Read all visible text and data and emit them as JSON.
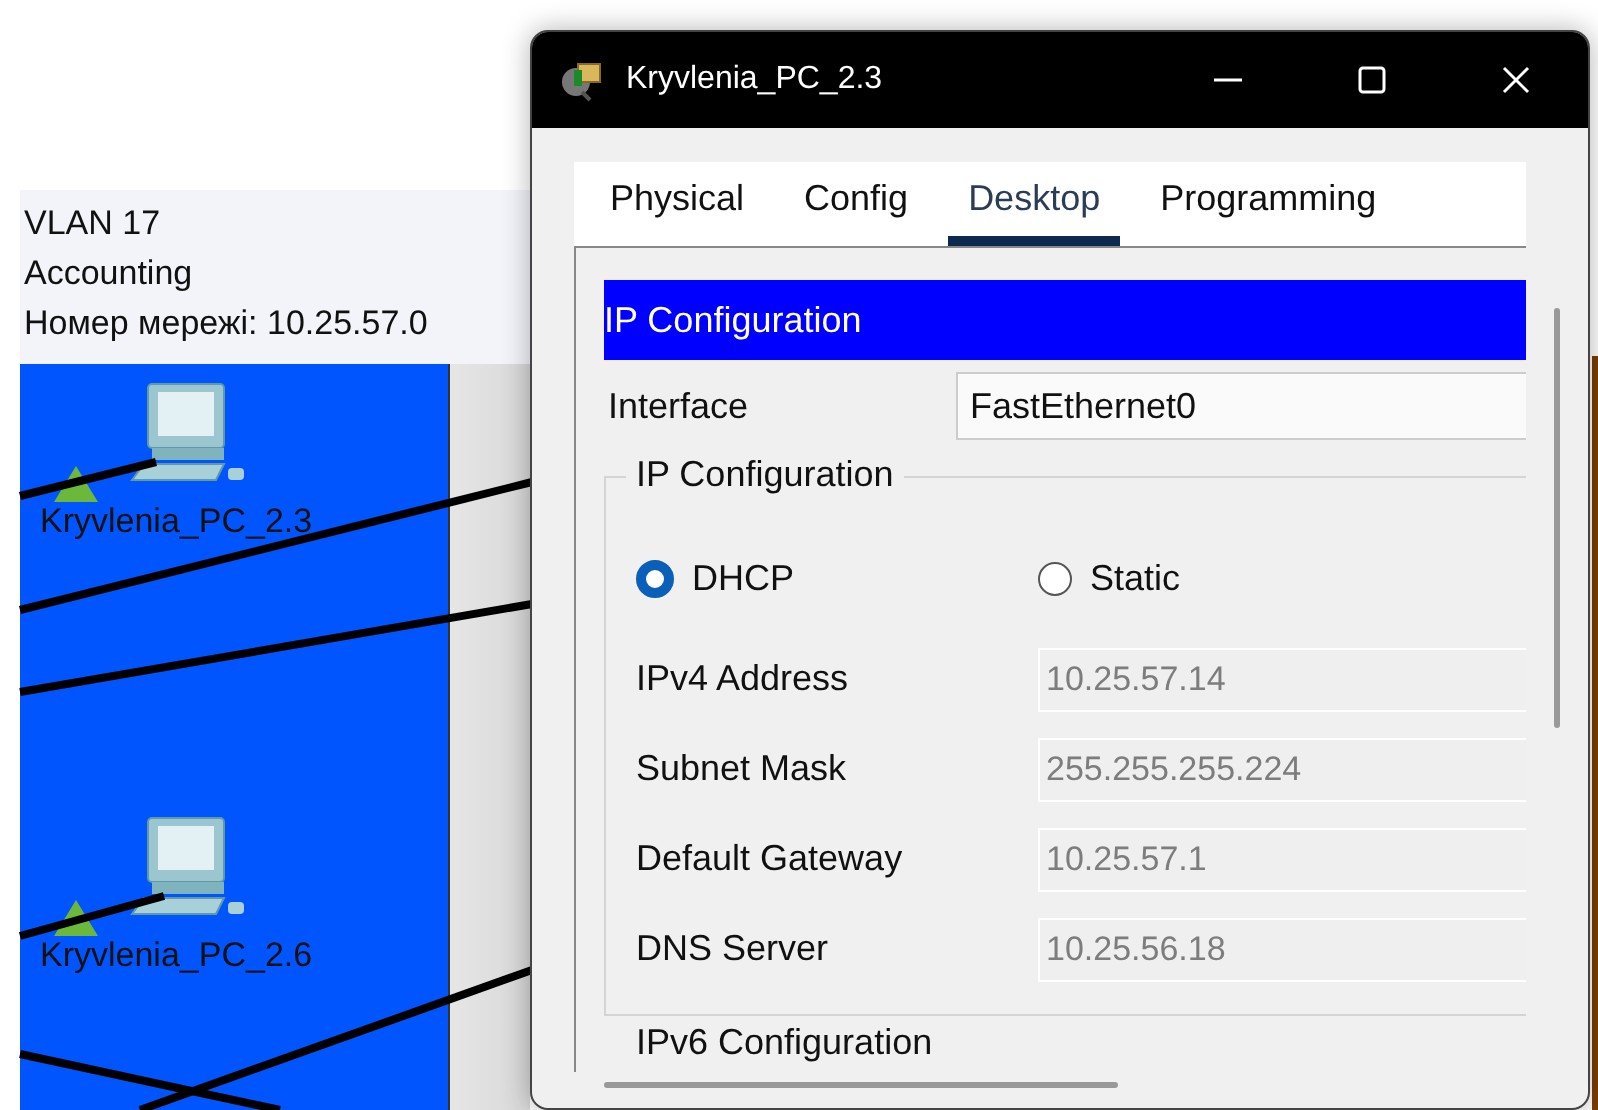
{
  "canvas": {
    "vlan_label": [
      "VLAN 17",
      "Accounting",
      "Номер мережі: 10.25.57.0"
    ],
    "devices": [
      {
        "label": "Kryvlenia_PC_2.3"
      },
      {
        "label": "Kryvlenia_PC_2.6"
      }
    ]
  },
  "window": {
    "title": "Kryvlenia_PC_2.3",
    "tabs": [
      {
        "label": "Physical",
        "selected": false
      },
      {
        "label": "Config",
        "selected": false
      },
      {
        "label": "Desktop",
        "selected": true
      },
      {
        "label": "Programming",
        "selected": false
      }
    ],
    "panel": {
      "header": "IP Configuration",
      "interface": {
        "label": "Interface",
        "value": "FastEthernet0"
      },
      "group": {
        "legend": "IP Configuration",
        "modes": [
          {
            "label": "DHCP",
            "selected": true
          },
          {
            "label": "Static",
            "selected": false
          }
        ],
        "fields": [
          {
            "label": "IPv4 Address",
            "value": "10.25.57.14",
            "disabled": true
          },
          {
            "label": "Subnet Mask",
            "value": "255.255.255.224",
            "disabled": true
          },
          {
            "label": "Default Gateway",
            "value": "10.25.57.1",
            "disabled": true
          },
          {
            "label": "DNS Server",
            "value": "10.25.56.18",
            "disabled": true
          }
        ]
      },
      "next_section": "IPv6 Configuration"
    }
  }
}
